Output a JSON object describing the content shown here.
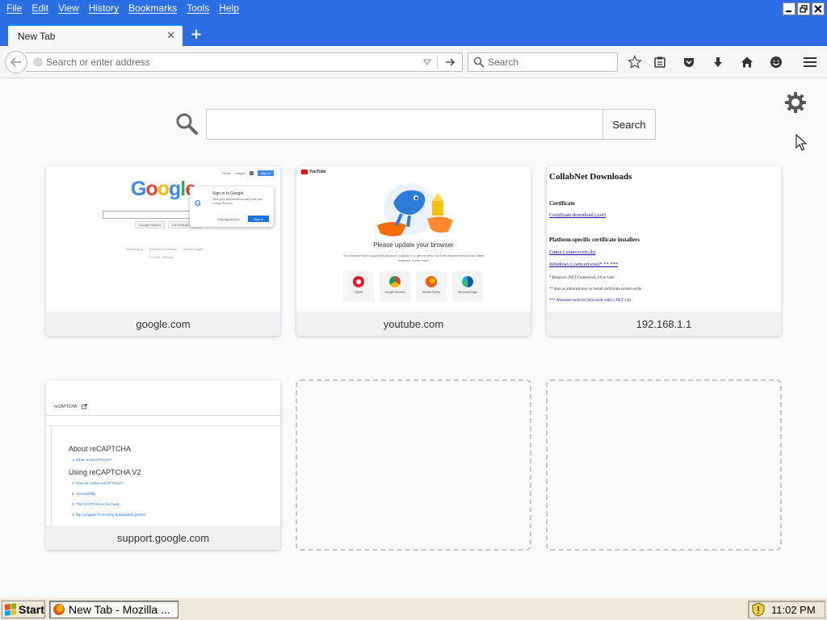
{
  "menubar": {
    "items": [
      "File",
      "Edit",
      "View",
      "History",
      "Bookmarks",
      "Tools",
      "Help"
    ],
    "window_controls": [
      "minimize-icon",
      "restore-icon",
      "close-icon"
    ]
  },
  "tabs": [
    {
      "title": "New Tab",
      "active": true
    }
  ],
  "navbar": {
    "url_placeholder": "Search or enter address",
    "search_placeholder": "Search",
    "toolbar_icons": [
      "star-icon",
      "reading-list-icon",
      "pocket-icon",
      "download-icon",
      "home-icon",
      "hello-icon",
      "hamburger-menu-icon"
    ]
  },
  "newtab": {
    "search_button": "Search",
    "tiles": [
      {
        "label": "google.com",
        "thumb": {
          "logo": "Google",
          "top_links": [
            "Gmail",
            "Images"
          ],
          "top_signin": "Sign in",
          "buttons": [
            "Google Search",
            "I'm Feeling Lucky"
          ],
          "popup_title": "Sign in to Google",
          "popup_text": "Save your passwords securely with your Google Account",
          "popup_stay": "Stay signed out",
          "popup_signin": "Sign in",
          "footer": [
            "Advertising",
            "Business Solutions",
            "About Google"
          ],
          "footer2": "© 2020 - Privacy"
        }
      },
      {
        "label": "youtube.com",
        "thumb": {
          "logo": "YouTube",
          "title": "Please update your browser",
          "subtitle": "Your browser isn't supported anymore. Update it to get the best YouTube experience and our latest features. Learn more",
          "browsers": [
            "Opera",
            "Google Chrome",
            "Mozilla Firefox",
            "Microsoft Edge"
          ]
        }
      },
      {
        "label": "192.168.1.1",
        "thumb": {
          "title": "CollabNet Downloads",
          "section1": "Certificate",
          "link1": "Certificate download (.cer)",
          "section2": "Platform-specific certificate installers",
          "link2": "Linux (.sourcecert.sh)",
          "link3": "Windows (.certcert.exe)* ** ***",
          "note1": "* Requires .NET Framework 4.0 or later",
          "note2": "** Run as administrator to install certificate system-wide",
          "note3": "*** Alternate build for Microsoft older (.NET 2.0)"
        }
      },
      {
        "label": "support.google.com",
        "thumb": {
          "header": "reCAPTCHA",
          "h1": "About reCAPTCHA",
          "l1": "1.   What is reCAPTCHA?",
          "h2": "Using reCAPTCHA V2",
          "l2": "1.   How do I solve reCAPTCHA?",
          "l3": "2.   Accessibility",
          "l4": "3.   This CAPTCHA is too hard",
          "l5": "4.   My computer is sending automated queries"
        }
      }
    ]
  },
  "taskbar": {
    "start_label": "Start",
    "task_label": "New Tab - Mozilla ...",
    "clock": "11:02 PM"
  },
  "colors": {
    "titlebar": "#2b6de3",
    "tab_accent": "#0a84ff",
    "content_bg": "#f9f9fa",
    "taskbar": "#ece9d8"
  }
}
